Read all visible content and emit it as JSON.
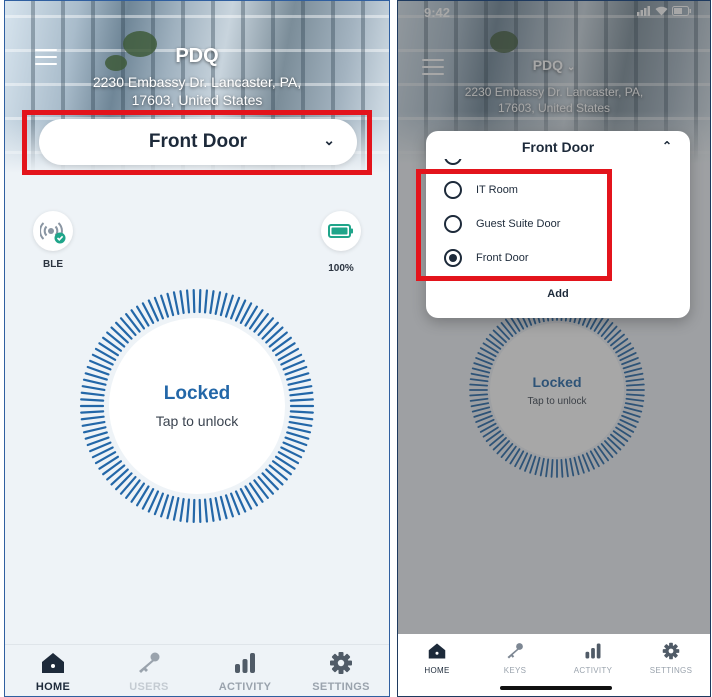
{
  "left": {
    "header": {
      "site_name": "PDQ",
      "address": "2230 Embassy Dr. Lancaster, PA, 17603, United States"
    },
    "door_selector": {
      "label": "Front Door"
    },
    "ble": {
      "label": "BLE"
    },
    "battery": {
      "label": "100%",
      "level": 1.0
    },
    "lock": {
      "state": "Locked",
      "hint": "Tap to unlock"
    },
    "tabs": [
      {
        "label": "HOME",
        "icon": "home-icon",
        "active": true
      },
      {
        "label": "USERS",
        "icon": "key-icon",
        "active": false
      },
      {
        "label": "ACTIVITY",
        "icon": "bar-chart-icon",
        "active": false
      },
      {
        "label": "SETTINGS",
        "icon": "gear-icon",
        "active": false
      }
    ]
  },
  "right": {
    "status_bar": {
      "time": "9:42"
    },
    "header": {
      "site_name": "PDQ",
      "address": "2230 Embassy Dr. Lancaster, PA, 17603, United States"
    },
    "dropdown": {
      "title": "Front Door",
      "options": [
        {
          "label": "IT Room",
          "selected": false
        },
        {
          "label": "Guest Suite Door",
          "selected": false
        },
        {
          "label": "Front Door",
          "selected": true
        }
      ],
      "add_label": "Add"
    },
    "lock": {
      "state": "Locked",
      "hint": "Tap to unlock"
    },
    "tabs": [
      {
        "label": "HOME",
        "icon": "home-icon",
        "active": true
      },
      {
        "label": "KEYS",
        "icon": "key-icon",
        "active": false
      },
      {
        "label": "ACTIVITY",
        "icon": "bar-chart-icon",
        "active": false
      },
      {
        "label": "SETTINGS",
        "icon": "gear-icon",
        "active": false
      }
    ]
  },
  "colors": {
    "accent": "#2367a8",
    "highlight": "#e3141c",
    "tab_active": "#1d2a3a",
    "tab_inactive": "#9aa3ad"
  }
}
